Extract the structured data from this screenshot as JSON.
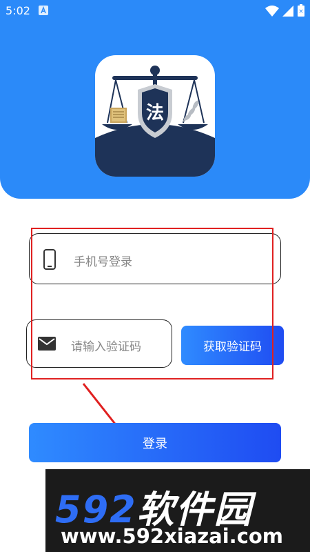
{
  "status_bar": {
    "time": "5:02",
    "icons": [
      "notification-a-icon",
      "wifi-icon",
      "signal-icon",
      "battery-icon"
    ]
  },
  "logo": {
    "character": "法"
  },
  "phone_field": {
    "placeholder": "手机号登录",
    "icon": "phone-icon"
  },
  "code_field": {
    "placeholder": "请输入验证码",
    "icon": "mail-icon"
  },
  "get_code_button": {
    "label": "获取验证码"
  },
  "login_button": {
    "label": "登录"
  },
  "watermark": {
    "brand_digits": "592",
    "brand_text": "软件园",
    "url": "www.592xiazai.com"
  },
  "colors": {
    "header_blue": "#2b8af9",
    "button_gradient_start": "#2f8bff",
    "button_gradient_end": "#1f4cf2",
    "logo_navy": "#1e3358",
    "annotation_red": "#e02020"
  }
}
